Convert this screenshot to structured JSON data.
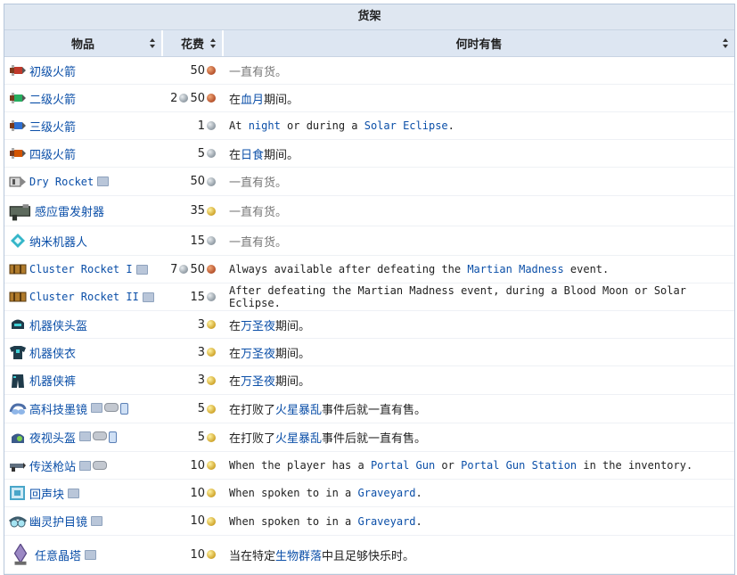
{
  "caption": "货架",
  "headers": {
    "item": "物品",
    "cost": "花费",
    "when": "何时有售"
  },
  "rows": [
    {
      "name": "初级火箭",
      "name_mono": false,
      "platforms": [],
      "cost": [
        [
          "50",
          "copper"
        ]
      ],
      "when": [
        [
          "一直有货。",
          "grey"
        ]
      ],
      "when_mono": false,
      "icon": "rocket-icon",
      "icon_color": "#c0392b"
    },
    {
      "name": "二级火箭",
      "name_mono": false,
      "platforms": [],
      "cost": [
        [
          "2",
          "silver"
        ],
        [
          "50",
          "copper"
        ]
      ],
      "when": [
        [
          "在",
          ""
        ],
        [
          "血月",
          "link"
        ],
        [
          "期间。",
          ""
        ]
      ],
      "when_mono": false,
      "icon": "rocket-icon",
      "icon_color": "#27ae60"
    },
    {
      "name": "三级火箭",
      "name_mono": false,
      "platforms": [],
      "cost": [
        [
          "1",
          "silver"
        ]
      ],
      "when": [
        [
          "At ",
          ""
        ],
        [
          "night",
          "link"
        ],
        [
          " or during a ",
          ""
        ],
        [
          "Solar Eclipse",
          "link"
        ],
        [
          ".",
          ""
        ]
      ],
      "when_mono": true,
      "icon": "rocket-icon",
      "icon_color": "#2e6fd1"
    },
    {
      "name": "四级火箭",
      "name_mono": false,
      "platforms": [],
      "cost": [
        [
          "5",
          "silver"
        ]
      ],
      "when": [
        [
          "在",
          ""
        ],
        [
          "日食",
          "link"
        ],
        [
          "期间。",
          ""
        ]
      ],
      "when_mono": false,
      "icon": "rocket-icon",
      "icon_color": "#d35400"
    },
    {
      "name": "Dry Rocket",
      "name_mono": true,
      "platforms": [
        "pc"
      ],
      "cost": [
        [
          "50",
          "silver"
        ]
      ],
      "when": [
        [
          "一直有货。",
          "grey"
        ]
      ],
      "when_mono": false,
      "icon": "dry-rocket-icon",
      "icon_color": "#9a9a9a"
    },
    {
      "name": "感应雷发射器",
      "name_mono": false,
      "platforms": [],
      "cost": [
        [
          "35",
          "gold"
        ]
      ],
      "when": [
        [
          "一直有货。",
          "grey"
        ]
      ],
      "when_mono": false,
      "icon": "proximity-mine-launcher-icon",
      "icon_color": "#5d6a5d",
      "big": true
    },
    {
      "name": "纳米机器人",
      "name_mono": false,
      "platforms": [],
      "cost": [
        [
          "15",
          "silver"
        ]
      ],
      "when": [
        [
          "一直有货。",
          "grey"
        ]
      ],
      "when_mono": false,
      "icon": "nanites-icon",
      "icon_color": "#35b6c9"
    },
    {
      "name": "Cluster Rocket I",
      "name_mono": true,
      "platforms": [
        "pc"
      ],
      "cost": [
        [
          "7",
          "silver"
        ],
        [
          "50",
          "copper"
        ]
      ],
      "when": [
        [
          "Always available after defeating the ",
          ""
        ],
        [
          "Martian Madness",
          "link"
        ],
        [
          " event.",
          ""
        ]
      ],
      "when_mono": true,
      "icon": "cluster-rocket-icon",
      "icon_color": "#b07b2c"
    },
    {
      "name": "Cluster Rocket II",
      "name_mono": true,
      "platforms": [
        "pc"
      ],
      "cost": [
        [
          "15",
          "silver"
        ]
      ],
      "when": [
        [
          "After defeating the Martian Madness event, during a Blood Moon or Solar Eclipse.",
          ""
        ]
      ],
      "when_mono": true,
      "icon": "cluster-rocket-icon",
      "icon_color": "#b07b2c"
    },
    {
      "name": "机器侠头盔",
      "name_mono": false,
      "platforms": [],
      "cost": [
        [
          "3",
          "gold"
        ]
      ],
      "when": [
        [
          "在",
          ""
        ],
        [
          "万圣夜",
          "link"
        ],
        [
          "期间。",
          ""
        ]
      ],
      "when_mono": false,
      "icon": "helmet-icon",
      "icon_color": "#1f3b4a"
    },
    {
      "name": "机器侠衣",
      "name_mono": false,
      "platforms": [],
      "cost": [
        [
          "3",
          "gold"
        ]
      ],
      "when": [
        [
          "在",
          ""
        ],
        [
          "万圣夜",
          "link"
        ],
        [
          "期间。",
          ""
        ]
      ],
      "when_mono": false,
      "icon": "shirt-icon",
      "icon_color": "#1f3b4a"
    },
    {
      "name": "机器侠裤",
      "name_mono": false,
      "platforms": [],
      "cost": [
        [
          "3",
          "gold"
        ]
      ],
      "when": [
        [
          "在",
          ""
        ],
        [
          "万圣夜",
          "link"
        ],
        [
          "期间。",
          ""
        ]
      ],
      "when_mono": false,
      "icon": "pants-icon",
      "icon_color": "#1f3b4a"
    },
    {
      "name": "高科技墨镜",
      "name_mono": false,
      "platforms": [
        "pc",
        "gp",
        "mob"
      ],
      "cost": [
        [
          "5",
          "gold"
        ]
      ],
      "when": [
        [
          "在打败了",
          ""
        ],
        [
          "火星暴乱",
          "link"
        ],
        [
          "事件后就一直有售。",
          ""
        ]
      ],
      "when_mono": false,
      "icon": "goggles-icon",
      "icon_color": "#4d6fa8"
    },
    {
      "name": "夜视头盔",
      "name_mono": false,
      "platforms": [
        "pc",
        "gp",
        "mob"
      ],
      "cost": [
        [
          "5",
          "gold"
        ]
      ],
      "when": [
        [
          "在打败了",
          ""
        ],
        [
          "火星暴乱",
          "link"
        ],
        [
          "事件后就一直有售。",
          ""
        ]
      ],
      "when_mono": false,
      "icon": "night-vision-icon",
      "icon_color": "#3b5a8a"
    },
    {
      "name": "传送枪站",
      "name_mono": false,
      "platforms": [
        "pc",
        "gp"
      ],
      "cost": [
        [
          "10",
          "gold"
        ]
      ],
      "when": [
        [
          "When the player has a ",
          ""
        ],
        [
          "Portal Gun",
          "link"
        ],
        [
          " or ",
          ""
        ],
        [
          "Portal Gun Station",
          "link"
        ],
        [
          " in the inventory.",
          ""
        ]
      ],
      "when_mono": true,
      "icon": "portal-gun-station-icon",
      "icon_color": "#5f6f7f"
    },
    {
      "name": "回声块",
      "name_mono": false,
      "platforms": [
        "pc"
      ],
      "cost": [
        [
          "10",
          "gold"
        ]
      ],
      "when": [
        [
          "When spoken to in a ",
          ""
        ],
        [
          "Graveyard",
          "link"
        ],
        [
          ".",
          ""
        ]
      ],
      "when_mono": true,
      "icon": "echo-block-icon",
      "icon_color": "#49a6c9"
    },
    {
      "name": "幽灵护目镜",
      "name_mono": false,
      "platforms": [
        "pc"
      ],
      "cost": [
        [
          "10",
          "gold"
        ]
      ],
      "when": [
        [
          "When spoken to in a ",
          ""
        ],
        [
          "Graveyard",
          "link"
        ],
        [
          ".",
          ""
        ]
      ],
      "when_mono": true,
      "icon": "spectre-goggles-icon",
      "icon_color": "#3d5d6d"
    },
    {
      "name": "任意晶塔",
      "name_mono": false,
      "platforms": [
        "pc"
      ],
      "cost": [
        [
          "10",
          "gold"
        ]
      ],
      "when": [
        [
          "当在特定",
          ""
        ],
        [
          "生物群落",
          "link"
        ],
        [
          "中且足够快乐时。",
          ""
        ]
      ],
      "when_mono": false,
      "icon": "pylon-icon",
      "icon_color": "#9b88c4",
      "big": true
    }
  ]
}
